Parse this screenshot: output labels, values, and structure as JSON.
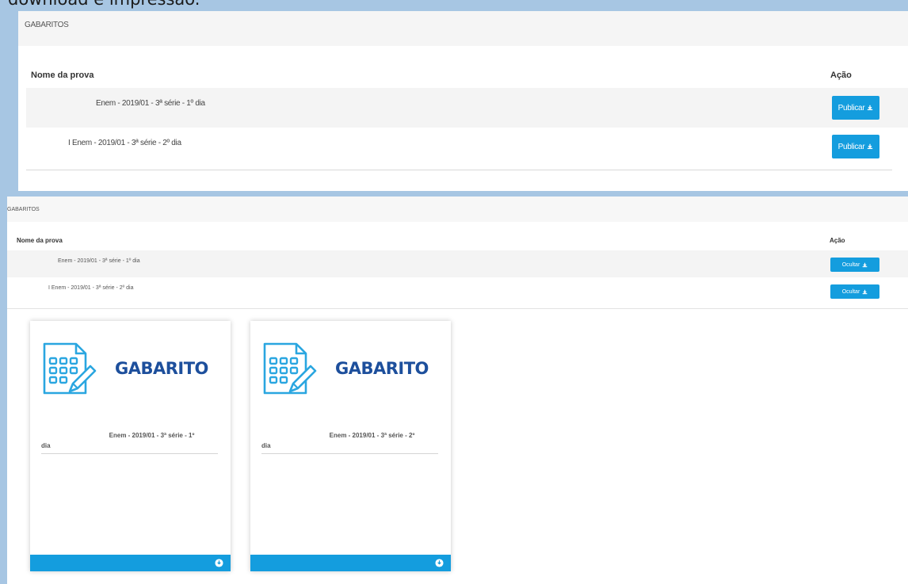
{
  "caption": "download e impressão.",
  "top_panel": {
    "header": "GABARITOS",
    "col_name": "Nome da prova",
    "col_action": "Ação",
    "rows": [
      {
        "name": "Enem - 2019/01 - 3ª série - 1º dia",
        "button": "Publicar"
      },
      {
        "name": "I Enem - 2019/01 - 3ª série - 2º dia",
        "button": "Publicar"
      }
    ]
  },
  "bottom_panel": {
    "header": "GABARITOS",
    "col_name": "Nome da prova",
    "col_action": "Ação",
    "rows": [
      {
        "name": "Enem - 2019/01 - 3ª série - 1º dia",
        "button": "Ocultar"
      },
      {
        "name": "I Enem - 2019/01 - 3ª série - 2º dia",
        "button": "Ocultar"
      }
    ],
    "cards": [
      {
        "title": "GABARITO",
        "name_line1": "Enem - 2019/01 - 3ª série - 1º",
        "name_line2": "dia",
        "icon": "answer-sheet-icon"
      },
      {
        "title": "GABARITO",
        "name_line1": "Enem - 2019/01 - 3ª série - 2º",
        "name_line2": "dia",
        "icon": "answer-sheet-icon"
      }
    ]
  },
  "colors": {
    "accent": "#149dde",
    "title": "#1d4f9c",
    "background": "#a7c6e3"
  }
}
